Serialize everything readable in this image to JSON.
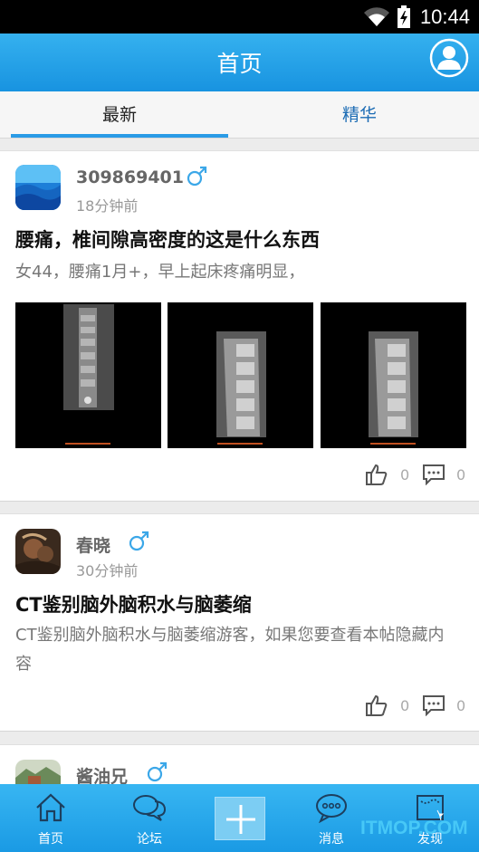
{
  "status": {
    "time": "10:44"
  },
  "header": {
    "title": "首页"
  },
  "tabs": [
    {
      "label": "最新"
    },
    {
      "label": "精华"
    }
  ],
  "posts": [
    {
      "username": "309869401",
      "time": "18分钟前",
      "title": "腰痛，椎间隙高密度的这是什么东西",
      "excerpt": "女44，腰痛1月+，早上起床疼痛明显，",
      "likes": "0",
      "comments": "0",
      "gender_icon": "male-icon"
    },
    {
      "username": "春晓",
      "time": "30分钟前",
      "title": "CT鉴别脑外脑积水与脑萎缩",
      "excerpt": "CT鉴别脑外脑积水与脑萎缩游客，如果您要查看本帖隐藏内容",
      "likes": "0",
      "comments": "0",
      "gender_icon": "male-icon"
    },
    {
      "username": "酱油兄",
      "gender_icon": "male-icon"
    }
  ],
  "bottom_nav": [
    {
      "label": "首页",
      "icon": "home-icon"
    },
    {
      "label": "论坛",
      "icon": "forum-icon"
    },
    {
      "label": "",
      "icon": "plus-icon"
    },
    {
      "label": "消息",
      "icon": "message-icon"
    },
    {
      "label": "发现",
      "icon": "discover-icon"
    }
  ],
  "watermark": "ITMOP.COM",
  "colors": {
    "accent": "#1f9ae6",
    "tab_inactive": "#1c6cb4",
    "gender": "#3ba7e8"
  }
}
